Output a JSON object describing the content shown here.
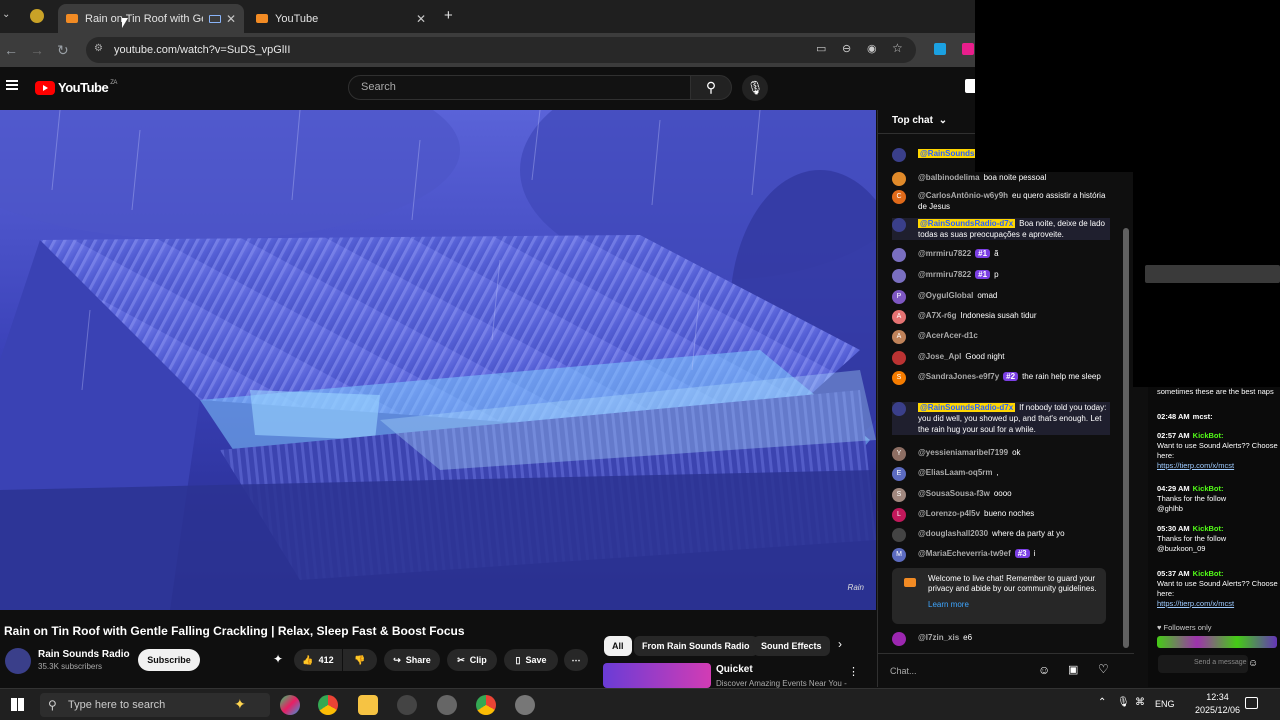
{
  "browser": {
    "tabs": [
      {
        "title": "Rain on Tin Roof with Gentl"
      },
      {
        "title": "YouTube"
      }
    ],
    "url": "youtube.com/watch?v=SuDS_vpGlII"
  },
  "youtube": {
    "logo_text": "YouTube",
    "country_code": "ZA",
    "search_placeholder": "Search"
  },
  "video": {
    "title": "Rain on Tin Roof with Gentle Falling Crackling | Relax, Sleep Fast & Boost Focus",
    "watermark": "Rain",
    "channel": "Rain Sounds Radio",
    "subscribers": "35.3K subscribers",
    "subscribe_label": "Subscribe",
    "like_count": "412",
    "share_label": "Share",
    "clip_label": "Clip",
    "save_label": "Save"
  },
  "chips": [
    "All",
    "From Rain Sounds Radio",
    "Sound Effects"
  ],
  "recommended": {
    "title": "Quicket",
    "subtitle": "Discover Amazing Events Near You -"
  },
  "chat": {
    "header": "Top chat",
    "pinned_name": "@RainSoundsR",
    "messages": [
      {
        "name": "@balbinodelima",
        "text": "boa noite pessoal",
        "color": "#e08a2a",
        "initial": ""
      },
      {
        "name": "@CarlosAntônio-w6y9h",
        "text": "eu quero assistir a história de Jesus",
        "color": "#e06a1a",
        "initial": "C"
      },
      {
        "name": "@RainSoundsRadio-d7x",
        "text": "Boa noite, deixe de lado todas as suas preocupações e aproveite.",
        "mod": true,
        "color": "#3a3f8a",
        "initial": ""
      },
      {
        "name": "@mrmiru7822",
        "badge": "#1",
        "text": "ã",
        "color": "#7a6fc0",
        "initial": ""
      },
      {
        "name": "@mrmiru7822",
        "badge": "#1",
        "text": "p",
        "color": "#7a6fc0",
        "initial": ""
      },
      {
        "name": "@OygulGlobal",
        "text": "omad",
        "color": "#7e57c2",
        "initial": "P"
      },
      {
        "name": "@A7X-r6g",
        "text": "Indonesia susah tidur",
        "color": "#e57373",
        "initial": "A"
      },
      {
        "name": "@AcerAcer-d1c",
        "text": "",
        "color": "#c0835a",
        "initial": "A"
      },
      {
        "name": "@Jose_Apl",
        "text": "Good night",
        "color": "#b33",
        "initial": ""
      },
      {
        "name": "@SandraJones-e9f7y",
        "badge": "#2",
        "text": "the rain help me sleep",
        "color": "#f57c00",
        "initial": "S"
      },
      {
        "name": "@RainSoundsRadio-d7x",
        "text": "If nobody told you today: you did well, you showed up, and that's enough. Let the rain hug your soul for a while.",
        "mod": true,
        "color": "#3a3f8a",
        "initial": ""
      },
      {
        "name": "@yessieniamaribel7199",
        "text": "ok",
        "color": "#8d6e63",
        "initial": "Y"
      },
      {
        "name": "@EliasLaam-oq5rm",
        "text": ",",
        "color": "#5c6bc0",
        "initial": "E"
      },
      {
        "name": "@SousaSousa-f3w",
        "text": "oooo",
        "color": "#a1887f",
        "initial": "S"
      },
      {
        "name": "@Lorenzo-p4l5v",
        "text": "bueno noches",
        "color": "#c2185b",
        "initial": "L"
      },
      {
        "name": "@douglashall2030",
        "text": "where da party at yo",
        "color": "#444",
        "initial": ""
      },
      {
        "name": "@MariaEcheverria-tw9ef",
        "badge": "#3",
        "text": "i",
        "color": "#5c6bc0",
        "initial": "M"
      }
    ],
    "welcome_text": "Welcome to live chat! Remember to guard your privacy and abide by our community guidelines.",
    "learn_more": "Learn more",
    "last_message": {
      "name": "@l7zin_xis",
      "text": "e6"
    },
    "input_placeholder": "Chat..."
  },
  "kick_chat": {
    "top_text": "sometimes these are the best naps",
    "messages": [
      {
        "time": "02:48 AM",
        "user": "mcst:",
        "text": ""
      },
      {
        "time": "02:57 AM",
        "user": "KickBot:",
        "text": "Want to use Sound Alerts?? Choose here:",
        "link": "https://tierp.com/x/mcst"
      },
      {
        "time": "04:29 AM",
        "user": "KickBot:",
        "text": "Thanks for the follow",
        "extra": "@ghlhb"
      },
      {
        "time": "05:30 AM",
        "user": "KickBot:",
        "text": "Thanks for the follow",
        "extra": "@buzkoon_09"
      },
      {
        "time": "05:37 AM",
        "user": "KickBot:",
        "text": "Want to use Sound Alerts?? Choose here:",
        "link": "https://tierp.com/x/mcst"
      }
    ],
    "followers_only": "Followers only",
    "send_label": "Send a message"
  },
  "taskbar": {
    "search_placeholder": "Type here to search",
    "lang": "ENG",
    "time": "12:34",
    "date": "2025/12/06"
  }
}
